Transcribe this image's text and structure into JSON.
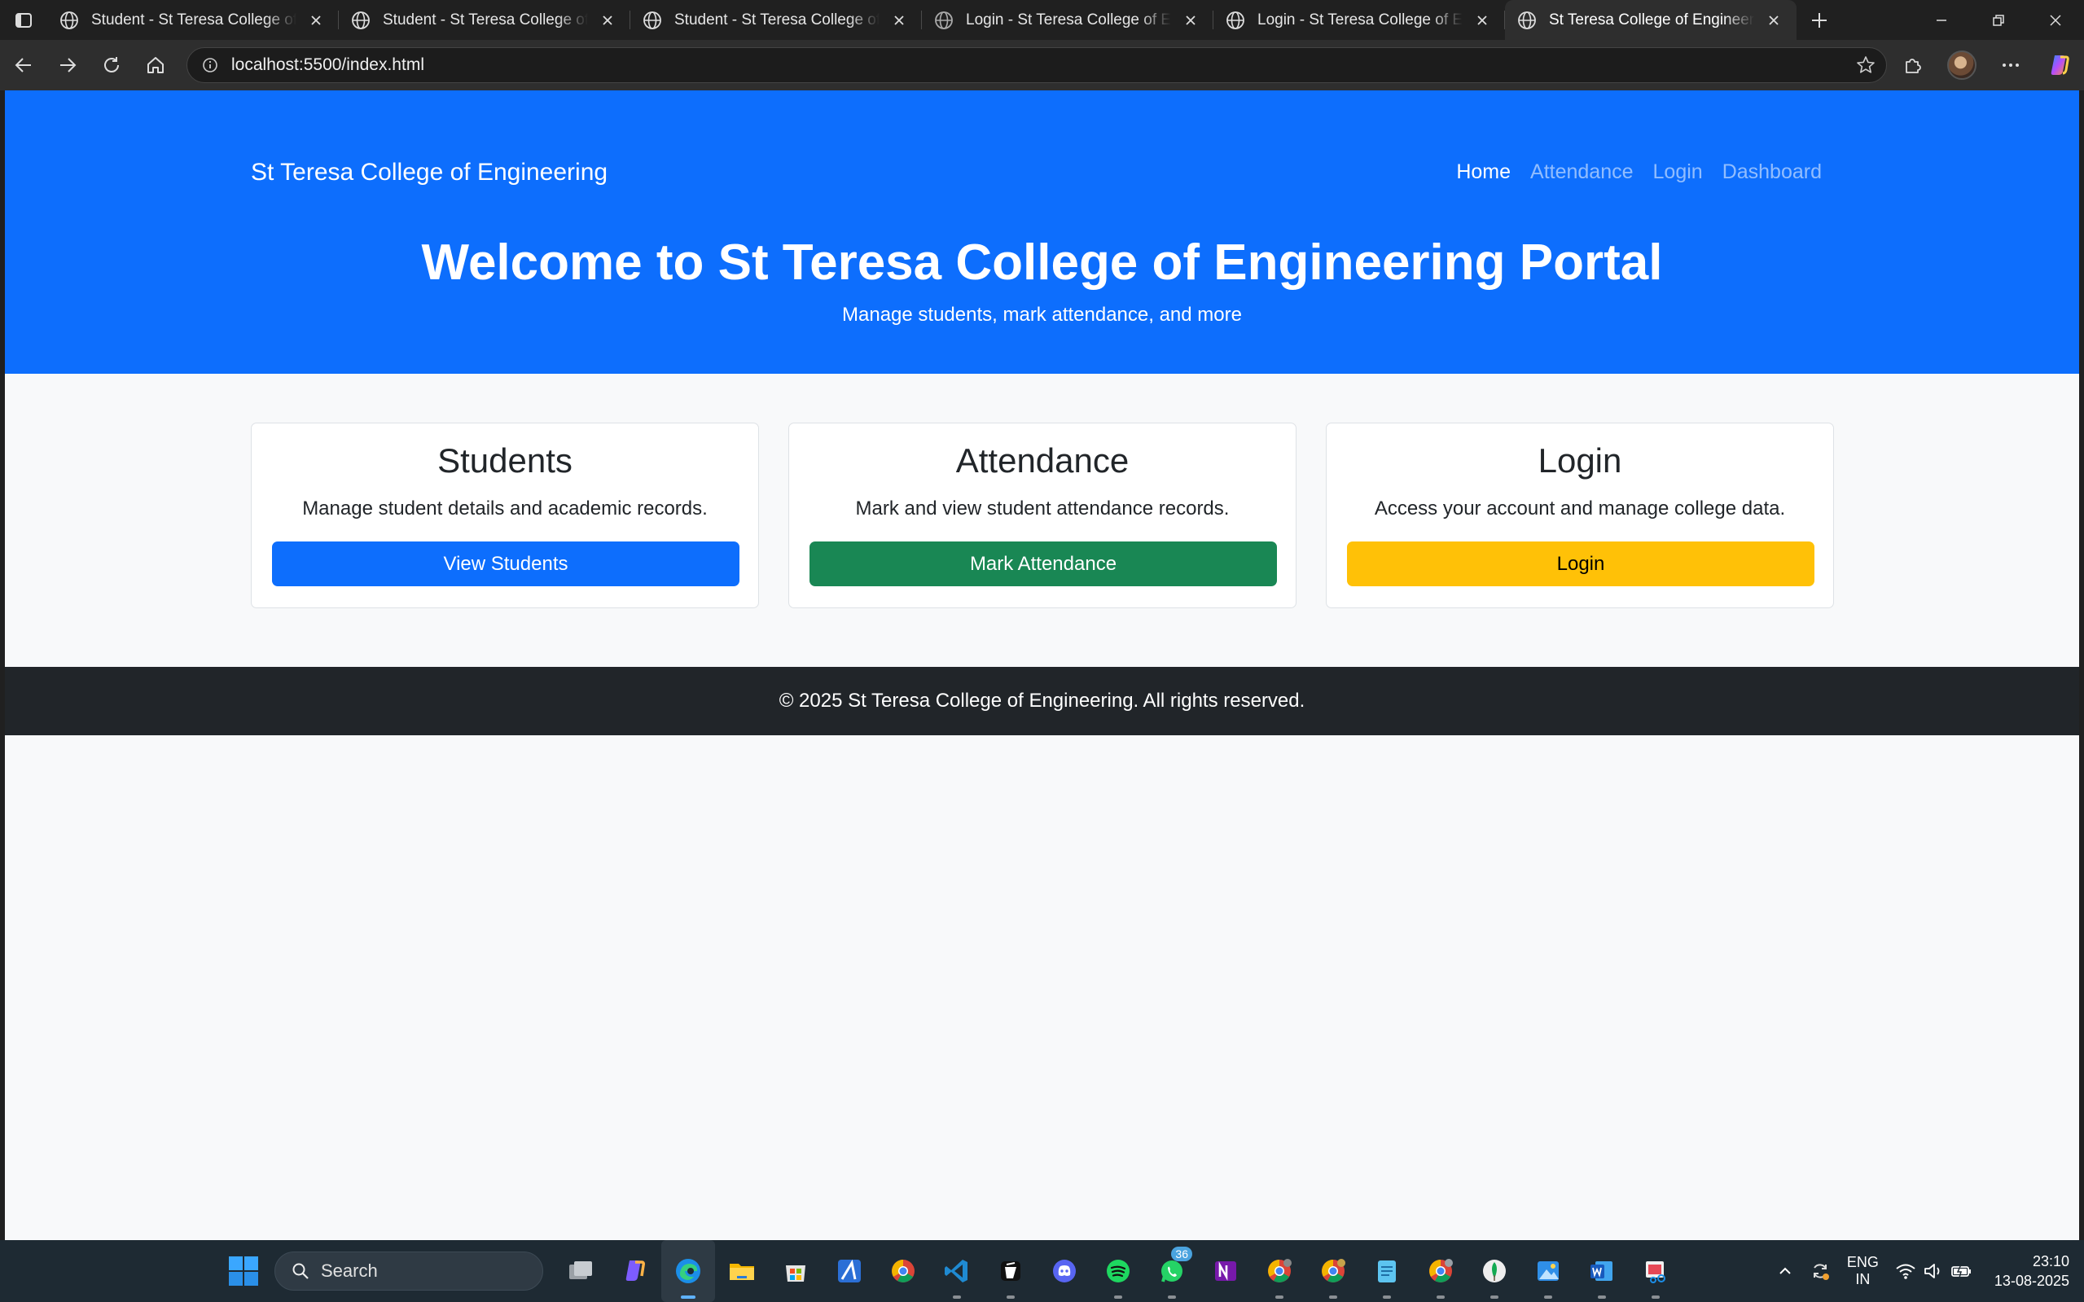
{
  "browser": {
    "tabs": [
      {
        "title": "Student - St Teresa College of Engineering",
        "active": false
      },
      {
        "title": "Student - St Teresa College of Engineering",
        "active": false
      },
      {
        "title": "Student - St Teresa College of Engineering",
        "active": false
      },
      {
        "title": "Login - St Teresa College of Engineering",
        "active": false
      },
      {
        "title": "Login - St Teresa College of Engineering",
        "active": false
      },
      {
        "title": "St Teresa College of Engineering Portal",
        "active": true
      }
    ],
    "address": "localhost:5500/index.html"
  },
  "page": {
    "navbar": {
      "brand": "St Teresa College of Engineering",
      "links": [
        "Home",
        "Attendance",
        "Login",
        "Dashboard"
      ],
      "active_link": "Home"
    },
    "hero": {
      "title": "Welcome to St Teresa College of Engineering Portal",
      "subtitle": "Manage students, mark attendance, and more"
    },
    "cards": [
      {
        "title": "Students",
        "text": "Manage student details and academic records.",
        "button": "View Students",
        "button_color": "#0d6efd",
        "button_text_color": "#ffffff"
      },
      {
        "title": "Attendance",
        "text": "Mark and view student attendance records.",
        "button": "Mark Attendance",
        "button_color": "#198754",
        "button_text_color": "#ffffff"
      },
      {
        "title": "Login",
        "text": "Access your account and manage college data.",
        "button": "Login",
        "button_color": "#ffc107",
        "button_text_color": "#000000"
      }
    ],
    "footer": "© 2025 St Teresa College of Engineering. All rights reserved.",
    "colors": {
      "primary": "#0d6efd",
      "dark": "#212529",
      "background": "#f8f9fa"
    }
  },
  "taskbar": {
    "search_placeholder": "Search",
    "whatsapp_badge": "36",
    "language": {
      "line1": "ENG",
      "line2": "IN"
    },
    "time": "23:10",
    "date": "13-08-2025"
  }
}
